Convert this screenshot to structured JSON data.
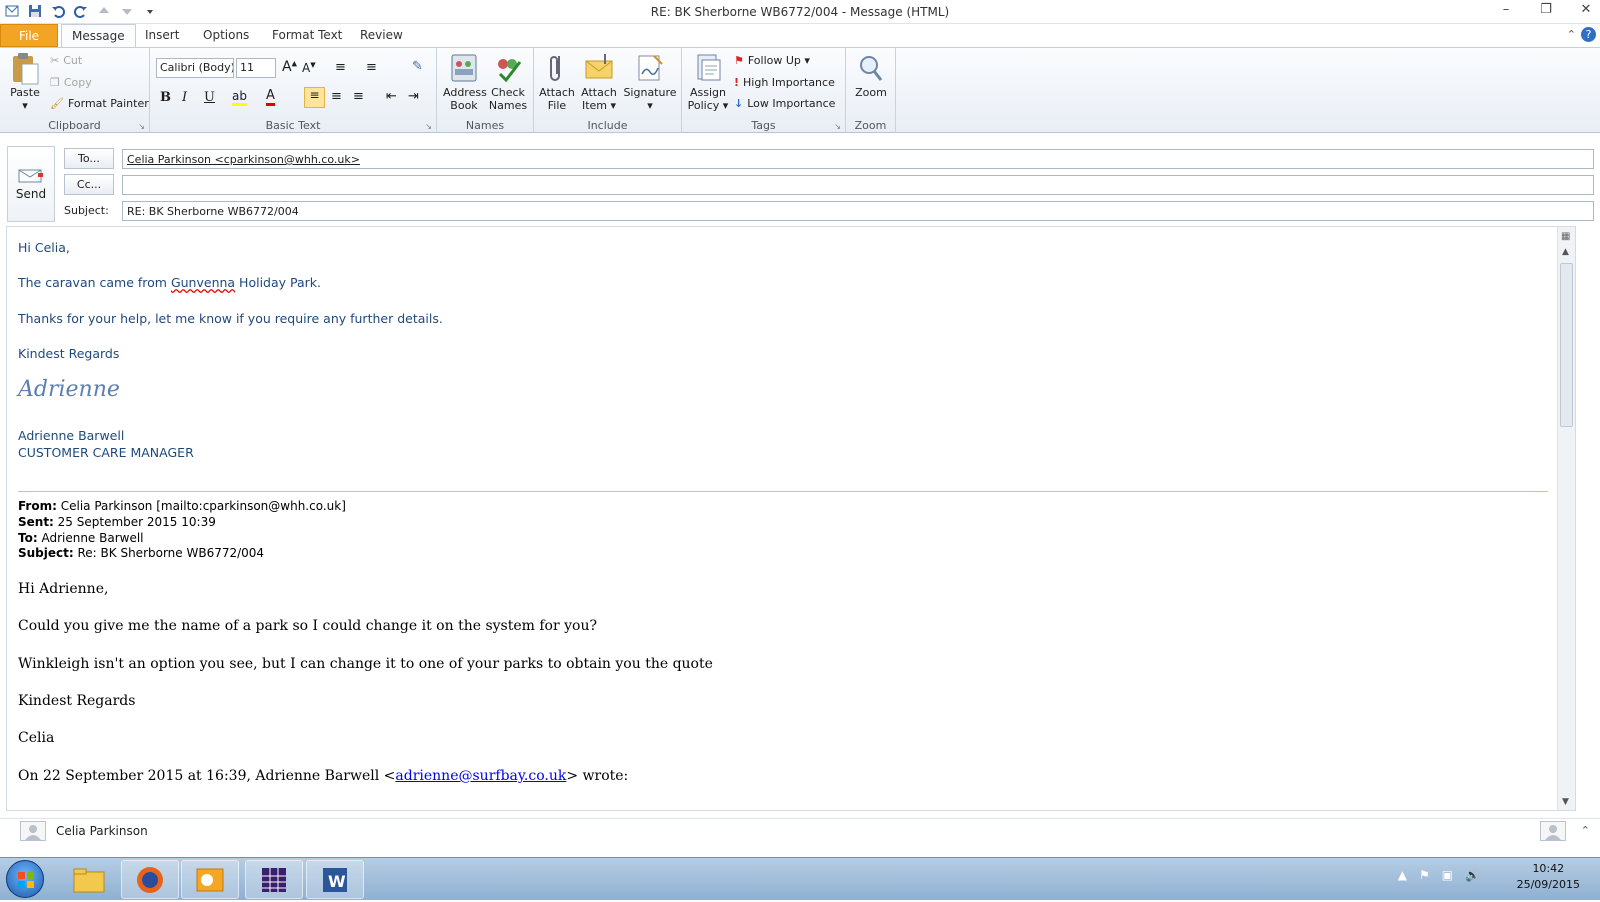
{
  "window": {
    "title": "RE: BK Sherborne WB6772/004  -  Message (HTML)"
  },
  "tabs": {
    "file": "File",
    "message": "Message",
    "insert": "Insert",
    "options": "Options",
    "format_text": "Format Text",
    "review": "Review"
  },
  "ribbon": {
    "clipboard": {
      "label": "Clipboard",
      "paste": "Paste",
      "cut": "Cut",
      "copy": "Copy",
      "format_painter": "Format Painter"
    },
    "basic_text": {
      "label": "Basic Text",
      "font": "Calibri (Body)",
      "size": "11"
    },
    "names": {
      "label": "Names",
      "address_book_1": "Address",
      "address_book_2": "Book",
      "check_names_1": "Check",
      "check_names_2": "Names"
    },
    "include": {
      "label": "Include",
      "attach_file_1": "Attach",
      "attach_file_2": "File",
      "attach_item_1": "Attach",
      "attach_item_2": "Item ▾",
      "signature": "Signature"
    },
    "tags": {
      "label": "Tags",
      "assign_policy_1": "Assign",
      "assign_policy_2": "Policy ▾",
      "follow_up": "Follow Up ▾",
      "high": "High Importance",
      "low": "Low Importance"
    },
    "zoom": {
      "label": "Zoom",
      "zoom": "Zoom"
    }
  },
  "compose": {
    "send": "Send",
    "to_button": "To...",
    "cc_button": "Cc...",
    "subject_label": "Subject:",
    "to_value": "Celia Parkinson <cparkinson@whh.co.uk>",
    "cc_value": "",
    "subject_value": "RE: BK Sherborne WB6772/004"
  },
  "body": {
    "greeting": "Hi Celia,",
    "line1_a": "The caravan came from ",
    "line1_b": "Gunvenna",
    "line1_c": " Holiday Park.",
    "line2": "Thanks for your help, let me know if you require any further details.",
    "regards": "Kindest Regards",
    "signature_script": "Adrienne",
    "sig_name": "Adrienne Barwell",
    "sig_title": "CUSTOMER CARE MANAGER",
    "q_from_label": "From:",
    "q_from": " Celia Parkinson [mailto:cparkinson@whh.co.uk]",
    "q_sent_label": "Sent:",
    "q_sent": " 25 September 2015 10:39",
    "q_to_label": "To:",
    "q_to": " Adrienne Barwell",
    "q_subject_label": "Subject:",
    "q_subject": " Re: BK Sherborne WB6772/004",
    "q_greeting": "Hi Adrienne,",
    "q_line1": "Could you give me the name of a park so I could change it on the system for you?",
    "q_line2": "Winkleigh isn't an option you see, but I can change it to one of your parks to obtain you the quote",
    "q_regards": "Kindest Regards",
    "q_name": "Celia",
    "q_wrote_a": "On 22 September 2015 at 16:39, Adrienne Barwell <",
    "q_wrote_link": "adrienne@surfbay.co.uk",
    "q_wrote_b": "> wrote:"
  },
  "status": {
    "contact": "Celia Parkinson"
  },
  "taskbar": {
    "time": "10:42",
    "date": "25/09/2015"
  }
}
